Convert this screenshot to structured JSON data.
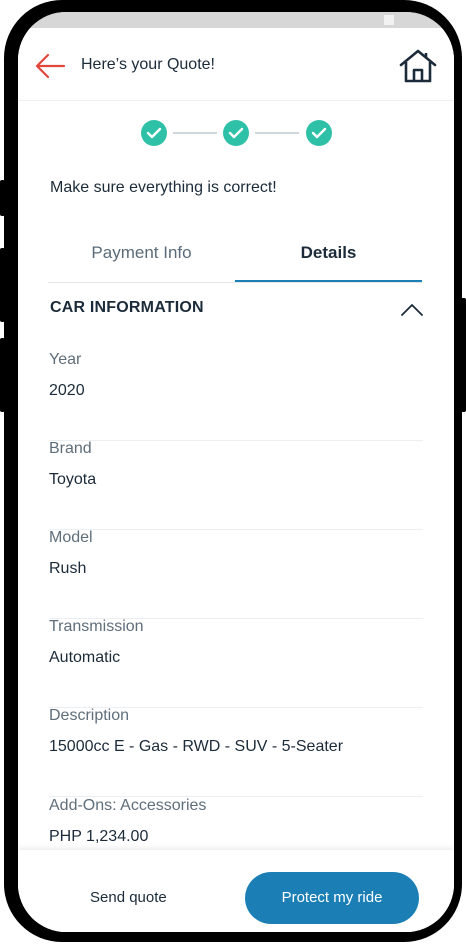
{
  "header": {
    "title": "Here’s your Quote!",
    "back_icon": "arrow-left-icon",
    "home_icon": "home-icon"
  },
  "stepper": {
    "steps_completed": 3,
    "steps_total": 3
  },
  "notice": "Make sure everything is correct!",
  "tabs": [
    {
      "label": "Payment Info",
      "active": false
    },
    {
      "label": "Details",
      "active": true
    }
  ],
  "section": {
    "title": "CAR INFORMATION",
    "expanded": true
  },
  "fields": [
    {
      "label": "Year",
      "value": "2020"
    },
    {
      "label": "Brand",
      "value": "Toyota"
    },
    {
      "label": "Model",
      "value": "Rush"
    },
    {
      "label": "Transmission",
      "value": "Automatic"
    },
    {
      "label": "Description",
      "value": "15000cc E - Gas - RWD - SUV - 5-Seater"
    },
    {
      "label": "Add-Ons: Accessories",
      "value": "PHP 1,234.00"
    }
  ],
  "footer": {
    "send_label": "Send quote",
    "protect_label": "Protect my ride"
  },
  "colors": {
    "accent": "#1b7fb6",
    "step_green": "#2fc1a8",
    "back_red": "#e2473b",
    "text": "#1c2b3a"
  }
}
